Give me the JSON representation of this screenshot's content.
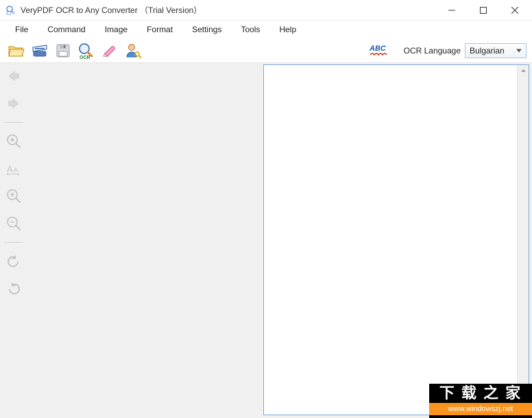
{
  "titlebar": {
    "title": "VeryPDF OCR to Any Converter （Trial Version）"
  },
  "menubar": {
    "items": [
      "File",
      "Command",
      "Image",
      "Format",
      "Settings",
      "Tools",
      "Help"
    ]
  },
  "toolbar": {
    "icons": {
      "open": "open-folder-icon",
      "scan": "scanner-icon",
      "save": "save-icon",
      "ocr": "ocr-magnifier-icon",
      "erase": "eraser-icon",
      "user": "user-key-icon",
      "abc": "abc-spellcheck-icon"
    },
    "ocr_language_label": "OCR Language",
    "language_value": "Bulgarian"
  },
  "watermark": {
    "cn_text": "下 载 之 家",
    "url_text": "www.windowszj.net"
  }
}
